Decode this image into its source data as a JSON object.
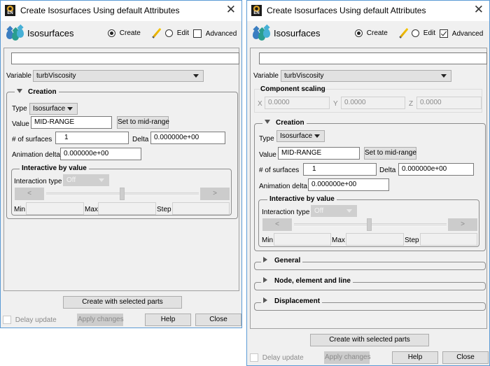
{
  "windows": [
    {
      "title": "Create Isosurfaces Using default Attributes",
      "app_icon_text": "EN",
      "header": {
        "title": "Isosurfaces",
        "mode_create": "Create",
        "mode_edit": "Edit",
        "advanced_label": "Advanced",
        "advanced_checked": false,
        "mode_selected": "Create"
      },
      "name_field": "",
      "variable": {
        "label": "Variable",
        "value": "turbViscosity"
      },
      "creation": {
        "title": "Creation",
        "expanded": true,
        "type_label": "Type",
        "type_value": "Isosurface",
        "value_label": "Value",
        "value_value": "MID-RANGE",
        "set_mid_button": "Set to mid-range",
        "surfaces_label": "# of surfaces",
        "surfaces_value": "1",
        "delta_label": "Delta",
        "delta_value": "0.000000e+00",
        "anim_delta_label": "Animation delta",
        "anim_delta_value": "0.000000e+00",
        "interactive": {
          "title": "Interactive by value",
          "type_label": "Interaction type",
          "type_value": "Off",
          "prev_label": "<",
          "next_label": ">",
          "min_label": "Min",
          "max_label": "Max",
          "step_label": "Step",
          "min_value": "",
          "max_value": "",
          "step_value": ""
        }
      },
      "footer": {
        "create_button": "Create with selected parts",
        "delay_update_label": "Delay update",
        "apply_button": "Apply changes",
        "help_button": "Help",
        "close_button": "Close"
      }
    },
    {
      "title": "Create Isosurfaces Using default Attributes",
      "app_icon_text": "EN",
      "header": {
        "title": "Isosurfaces",
        "mode_create": "Create",
        "mode_edit": "Edit",
        "advanced_label": "Advanced",
        "advanced_checked": true,
        "mode_selected": "Create"
      },
      "name_field": "",
      "variable": {
        "label": "Variable",
        "value": "turbViscosity"
      },
      "component_scaling": {
        "title": "Component scaling",
        "x_label": "X",
        "x_value": "0.0000",
        "y_label": "Y",
        "y_value": "0.0000",
        "z_label": "Z",
        "z_value": "0.0000"
      },
      "creation": {
        "title": "Creation",
        "expanded": true,
        "type_label": "Type",
        "type_value": "Isosurface",
        "value_label": "Value",
        "value_value": "MID-RANGE",
        "set_mid_button": "Set to mid-range",
        "surfaces_label": "# of surfaces",
        "surfaces_value": "1",
        "delta_label": "Delta",
        "delta_value": "0.000000e+00",
        "anim_delta_label": "Animation delta",
        "anim_delta_value": "0.000000e+00",
        "interactive": {
          "title": "Interactive by value",
          "type_label": "Interaction type",
          "type_value": "Off",
          "prev_label": "<",
          "next_label": ">",
          "min_label": "Min",
          "max_label": "Max",
          "step_label": "Step",
          "min_value": "",
          "max_value": "",
          "step_value": ""
        }
      },
      "collapsed_sections": [
        {
          "title": "General"
        },
        {
          "title": "Node, element and line"
        },
        {
          "title": "Displacement"
        }
      ],
      "footer": {
        "create_button": "Create with selected parts",
        "delay_update_label": "Delay update",
        "apply_button": "Apply changes",
        "help_button": "Help",
        "close_button": "Close"
      }
    }
  ]
}
